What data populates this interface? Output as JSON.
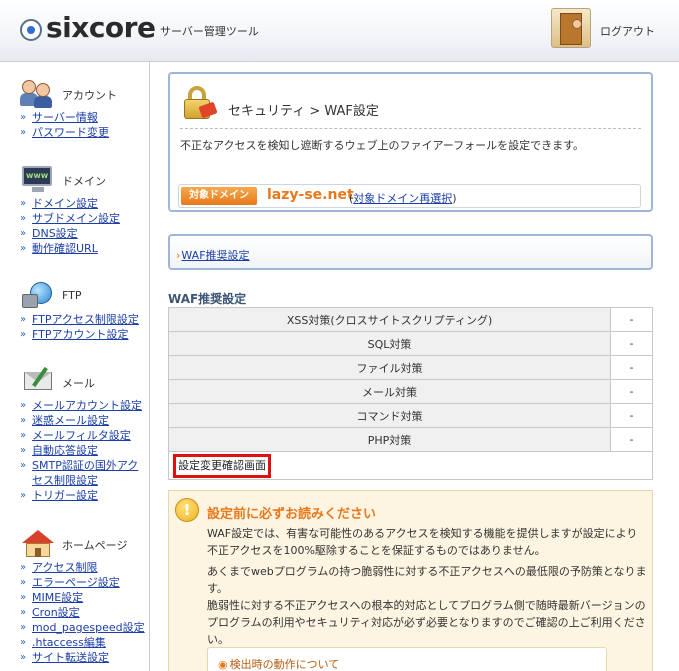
{
  "header": {
    "logo_text": "sixcore",
    "logo_sub": "サーバー管理ツール",
    "logout_label": "ログアウト"
  },
  "sidebar": {
    "groups": [
      {
        "title": "アカウント",
        "icon": "account-icon",
        "links": [
          "サーバー情報",
          "パスワード変更"
        ]
      },
      {
        "title": "ドメイン",
        "icon": "domain-icon",
        "links": [
          "ドメイン設定",
          "サブドメイン設定",
          "DNS設定",
          "動作確認URL"
        ]
      },
      {
        "title": "FTP",
        "icon": "ftp-icon",
        "links": [
          "FTPアクセス制限設定",
          "FTPアカウント設定"
        ]
      },
      {
        "title": "メール",
        "icon": "mail-icon",
        "links": [
          "メールアカウント設定",
          "迷惑メール設定",
          "メールフィルタ設定",
          "自動応答設定",
          "SMTP認証の国外アクセス制限設定",
          "トリガー設定"
        ]
      },
      {
        "title": "ホームページ",
        "icon": "home-icon",
        "links": [
          "アクセス制限",
          "エラーページ設定",
          "MIME設定",
          "Cron設定",
          "mod_pagespeed設定",
          ".htaccess編集",
          "サイト転送設定"
        ]
      }
    ]
  },
  "main": {
    "title": "セキュリティ > WAF設定",
    "description": "不正なアクセスを検知し遮断するウェブ上のファイアーフォールを設定できます。",
    "domain_tag": "対象ドメイン",
    "domain_name": "lazy-se.net",
    "domain_reselect_open": "(",
    "domain_reselect": "対象ドメイン再選択",
    "domain_reselect_close": ")",
    "nav_link": "WAF推奨設定",
    "section_title": "WAF推奨設定",
    "waf_rows": [
      {
        "name": "XSS対策(クロスサイトスクリプティング)",
        "value": "-"
      },
      {
        "name": "SQL対策",
        "value": "-"
      },
      {
        "name": "ファイル対策",
        "value": "-"
      },
      {
        "name": "メール対策",
        "value": "-"
      },
      {
        "name": "コマンド対策",
        "value": "-"
      },
      {
        "name": "PHP対策",
        "value": "-"
      }
    ],
    "confirm_button": "設定変更確認画面",
    "notice": {
      "title": "設定前に必ずお読みください",
      "p1": "WAF設定では、有害な可能性のあるアクセスを検知する機能を提供しますが設定により不正アクセスを100%駆除することを保証するものではありません。",
      "p2": "あくまでwebプログラムの持つ脆弱性に対する不正アクセスへの最低限の予防策となります。",
      "p3": "脆弱性に対する不正アクセスへの根本的対応としてプログラム側で随時最新バージョンのプログラムの利用やセキュリティ対応が必ず必要となりますのでご確認の上ご利用ください。",
      "sub_link": "検出時の動作について"
    }
  },
  "colors": {
    "accent_orange": "#e8781b",
    "link_blue": "#1b3ea8",
    "box_border": "#9fb6d6",
    "highlight_red": "#e01010"
  }
}
